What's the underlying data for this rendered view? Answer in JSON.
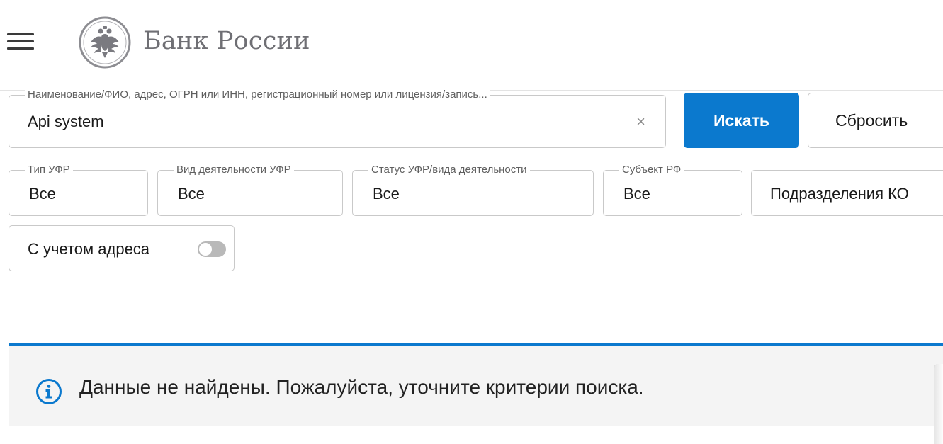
{
  "header": {
    "brand": "Банк России",
    "menu_icon": "hamburger-icon",
    "logo_icon": "double-headed-eagle-emblem"
  },
  "search": {
    "legend": "Наименование/ФИО, адрес, ОГРН или ИНН, регистрационный номер или лицензия/запись...",
    "value": "Api system",
    "clear_symbol": "×",
    "search_button": "Искать",
    "reset_button": "Сбросить"
  },
  "filters": [
    {
      "legend": "Тип УФР",
      "value": "Все"
    },
    {
      "legend": "Вид деятельности УФР",
      "value": "Все"
    },
    {
      "legend": "Статус УФР/вида деятельности",
      "value": "Все"
    },
    {
      "legend": "Субъект РФ",
      "value": "Все"
    },
    {
      "legend": "",
      "value": "Подразделения КО"
    }
  ],
  "address_toggle": {
    "label": "С учетом адреса",
    "checked": false
  },
  "result": {
    "icon": "info-icon",
    "message": "Данные не найдены. Пожалуйста, уточните критерии поиска."
  },
  "colors": {
    "accent": "#0b79ce",
    "banner_bg": "#f4f4f4",
    "border": "#c9c9c9"
  }
}
